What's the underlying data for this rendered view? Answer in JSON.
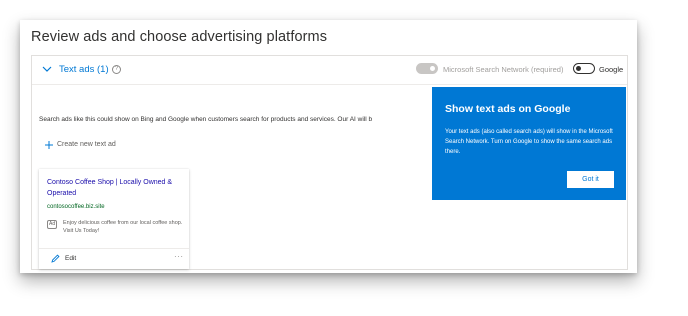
{
  "page": {
    "title": "Review ads and choose advertising platforms"
  },
  "section": {
    "title": "Text ads (1)",
    "info_icon_glyph": "?",
    "toggles": {
      "microsoft_label": "Microsoft Search Network (required)",
      "microsoft_on": true,
      "microsoft_disabled": true,
      "google_label": "Google",
      "google_on": false
    },
    "description": "Search ads like this could show on Bing and Google when customers search for products and services. Our AI will b",
    "create_label": "Create new text ad"
  },
  "ad": {
    "title": "Contoso Coffee Shop | Locally Owned & Operated",
    "url": "contosocoffee.biz.site",
    "badge": "Ad",
    "text": "Enjoy delicious coffee from our local coffee shop. Visit Us Today!",
    "edit_label": "Edit",
    "more_glyph": "···"
  },
  "callout": {
    "title": "Show text ads on Google",
    "body": "Your text ads (also called search ads) will show in the Microsoft Search Network. Turn on Google to show the same search ads there.",
    "button_label": "Got it"
  },
  "colors": {
    "accent": "#0078d4",
    "ad_title": "#1a0dab",
    "ad_url": "#006621"
  }
}
